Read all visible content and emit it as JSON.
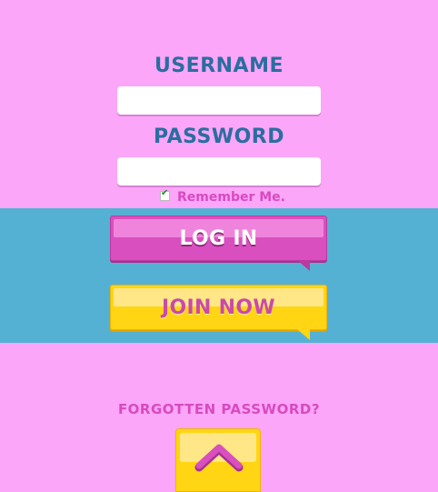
{
  "form": {
    "username_label": "USERNAME",
    "username_value": "",
    "password_label": "PASSWORD",
    "password_value": "",
    "remember_label": "Remember Me.",
    "remember_checked": true,
    "checkmark": "✔"
  },
  "actions": {
    "login_label": "LOG IN",
    "join_label": "JOIN NOW"
  },
  "footer": {
    "forgot_label": "FORGOTTEN PASSWORD?",
    "scroll_top_icon": "chevron-up-icon"
  },
  "colors": {
    "background_pink": "#fba6f8",
    "band_blue": "#55b1d4",
    "label_blue": "#2a6ea0",
    "accent_magenta": "#d94fbf",
    "accent_yellow": "#ffd514"
  }
}
